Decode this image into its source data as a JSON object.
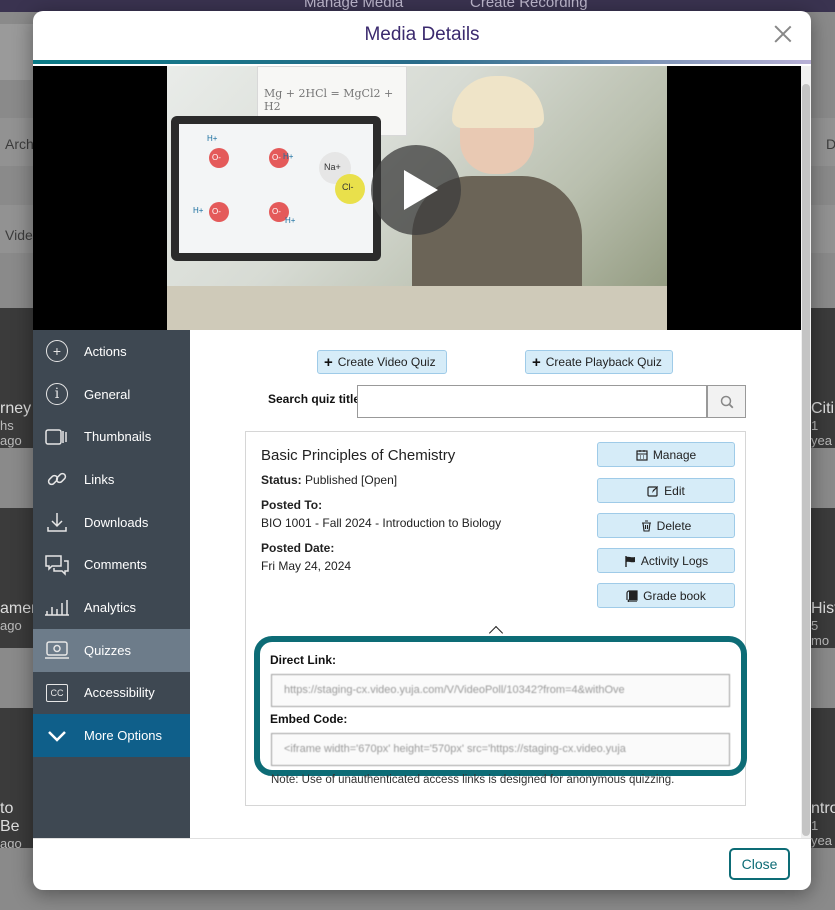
{
  "background": {
    "top_items": [
      "Manage Media",
      "Create Recording"
    ],
    "partial_texts": [
      "Arch",
      "Vide",
      "D"
    ],
    "tiles": [
      {
        "title": "rney",
        "subtitle": "hs ago"
      },
      {
        "title": "amen",
        "subtitle": "ago"
      },
      {
        "title": "to Be",
        "subtitle": "ago"
      },
      {
        "title": "Citin",
        "subtitle": "1 yea"
      },
      {
        "title": "Histo",
        "subtitle": "5 mo"
      },
      {
        "title": "ntro",
        "subtitle": "1 yea"
      }
    ]
  },
  "modal": {
    "title": "Media Details",
    "close_label": "Close"
  },
  "video": {
    "molecule_labels": [
      "H+",
      "O-",
      "H+",
      "O-",
      "H+",
      "O-",
      "H+",
      "O-",
      "Na+",
      "Cl-"
    ],
    "board_text": "Mg + 2HCl = MgCl2 + H2"
  },
  "sidebar": {
    "items": [
      {
        "label": "Actions",
        "icon": "plus-circle-icon"
      },
      {
        "label": "General",
        "icon": "info-icon"
      },
      {
        "label": "Thumbnails",
        "icon": "thumbnails-icon"
      },
      {
        "label": "Links",
        "icon": "link-icon"
      },
      {
        "label": "Downloads",
        "icon": "download-icon"
      },
      {
        "label": "Comments",
        "icon": "comments-icon"
      },
      {
        "label": "Analytics",
        "icon": "analytics-icon"
      },
      {
        "label": "Quizzes",
        "icon": "quiz-icon"
      },
      {
        "label": "Accessibility",
        "icon": "cc-icon"
      },
      {
        "label": "More Options",
        "icon": "chevron-down-icon"
      }
    ],
    "active": "Quizzes"
  },
  "quizzes": {
    "create_video_quiz": "Create Video Quiz",
    "create_playback_quiz": "Create Playback Quiz",
    "search_label": "Search quiz title",
    "search_value": "",
    "card": {
      "title": "Basic Principles of Chemistry",
      "status_label": "Status:",
      "status_value": "Published [Open]",
      "posted_to_label": "Posted To:",
      "posted_to_value": "BIO 1001 - Fall 2024 - Introduction to Biology",
      "posted_date_label": "Posted Date:",
      "posted_date_value": "Fri May 24, 2024",
      "actions": [
        "Manage",
        "Edit",
        "Delete",
        "Activity Logs",
        "Grade book"
      ],
      "direct_link_label": "Direct Link:",
      "direct_link_value": "https://staging-cx.video.yuja.com/V/VideoPoll/10342?from=4&withOve",
      "embed_code_label": "Embed Code:",
      "embed_code_value": "<iframe width='670px' height='570px' src='https://staging-cx.video.yuja",
      "note": "Note: Use of unauthenticated access links is designed for anonymous quizzing."
    }
  },
  "colors": {
    "accent": "#0d6c76",
    "title": "#3b2a6e",
    "sidebar": "#3e4852",
    "sidebar_active": "#6d7c8a",
    "more_options": "#0f5f8a",
    "button_fill": "#d6ecf8"
  }
}
